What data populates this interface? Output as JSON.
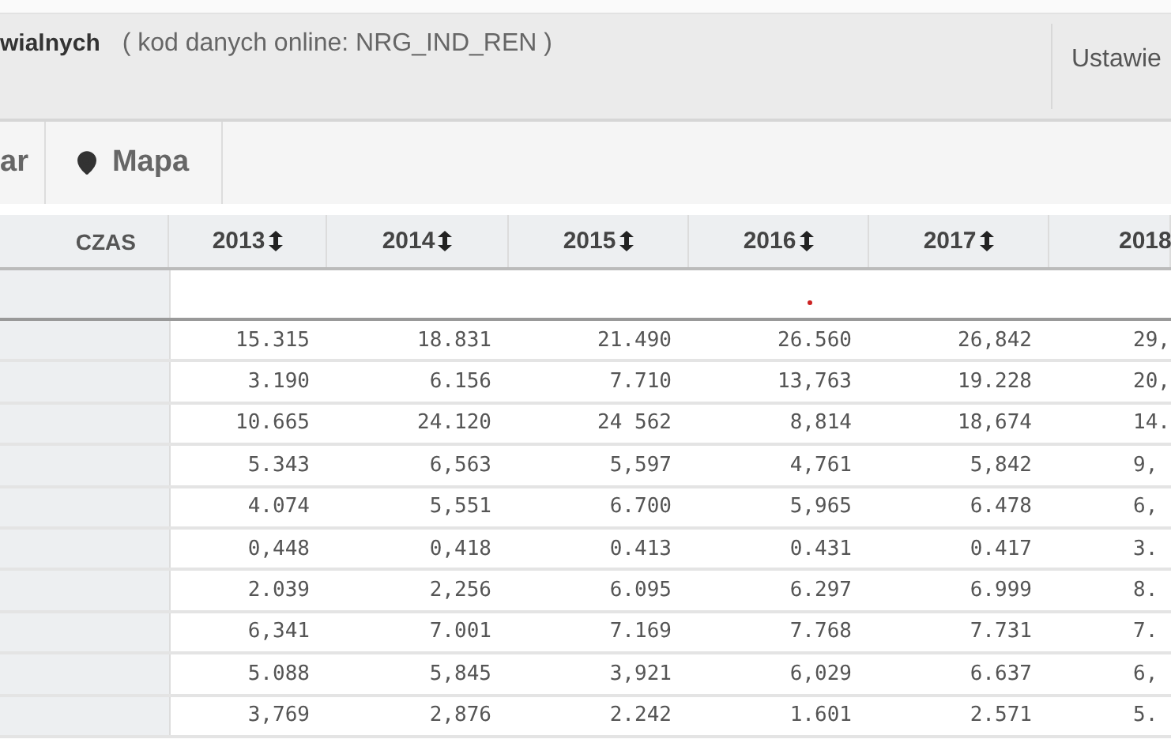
{
  "header": {
    "title_fragment": "wialnych",
    "dataset_code": "( kod danych online: NRG_IND_REN )",
    "settings_label": "Ustawie"
  },
  "view_tabs": [
    {
      "label": "ar",
      "kind": "text"
    },
    {
      "label": "Mapa",
      "kind": "map"
    }
  ],
  "table": {
    "corner_label": "CZAS",
    "columns": [
      "2013",
      "2014",
      "2015",
      "2016",
      "2017",
      "2018"
    ],
    "rows": [
      [
        "15.315",
        "18.831",
        "21.490",
        "26.560",
        "26,842",
        "29,"
      ],
      [
        "3.190",
        "6.156",
        "7.710",
        "13,763",
        "19.228",
        "20,"
      ],
      [
        "10.665",
        "24.120",
        "24 562",
        "8,814",
        "18,674",
        "14."
      ],
      [
        "5.343",
        "6,563",
        "5,597",
        "4,761",
        "5,842",
        "9,"
      ],
      [
        "4.074",
        "5,551",
        "6.700",
        "5,965",
        "6.478",
        "6,"
      ],
      [
        "0,448",
        "0,418",
        "0.413",
        "0.431",
        "0.417",
        "3."
      ],
      [
        "2.039",
        "2,256",
        "6.095",
        "6.297",
        "6.999",
        "8."
      ],
      [
        "6,341",
        "7.001",
        "7.169",
        "7.768",
        "7.731",
        "7."
      ],
      [
        "5.088",
        "5,845",
        "3,921",
        "6,029",
        "6.637",
        "6,"
      ],
      [
        "3,769",
        "2,876",
        "2.242",
        "1.601",
        "2.571",
        "5."
      ]
    ]
  }
}
